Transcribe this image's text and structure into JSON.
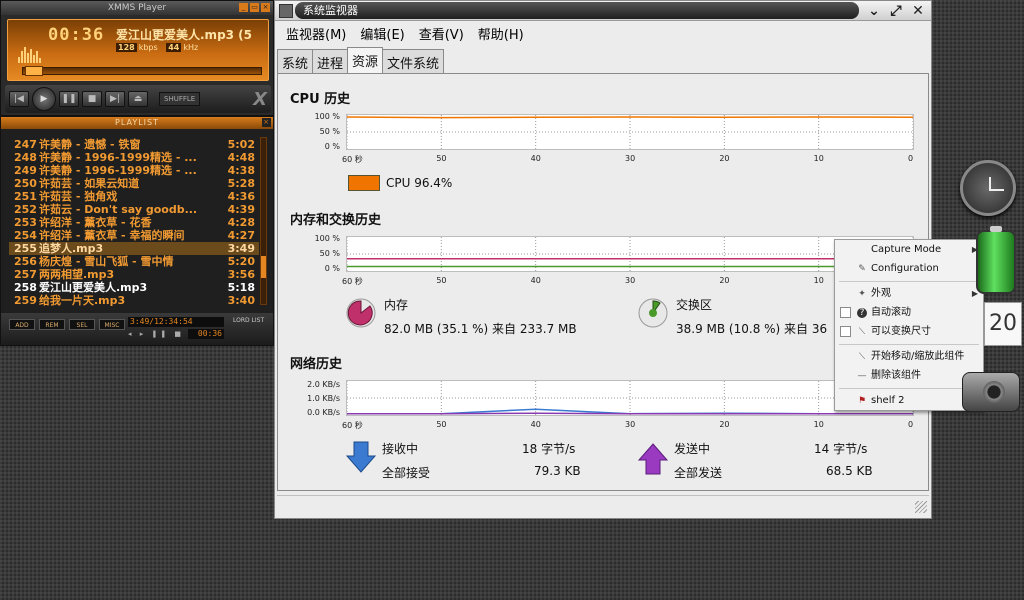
{
  "xmms": {
    "title": "XMMS Player",
    "time": "00:36",
    "song": "爱江山更爱美人.mp3 (5",
    "bitrate": "128",
    "bitrate_unit": "kbps",
    "samplerate": "44",
    "samplerate_unit": "kHz",
    "shuffle_label": "SHUFFLE",
    "logo": "X"
  },
  "playlist": {
    "title": "PLAYLIST",
    "rows": [
      {
        "num": "247",
        "title": "许美静 - 遗憾 - 铁窗",
        "dur": "5:02"
      },
      {
        "num": "248",
        "title": "许美静 - 1996-1999精选 - ...",
        "dur": "4:48"
      },
      {
        "num": "249",
        "title": "许美静 - 1996-1999精选 - ...",
        "dur": "4:38"
      },
      {
        "num": "250",
        "title": "许茹芸 - 如果云知道",
        "dur": "5:28"
      },
      {
        "num": "251",
        "title": "许茹芸 - 独角戏",
        "dur": "4:36"
      },
      {
        "num": "252",
        "title": "许茹云 - Don't say goodb...",
        "dur": "4:39"
      },
      {
        "num": "253",
        "title": "许绍洋 - 薰衣草 - 花香",
        "dur": "4:28"
      },
      {
        "num": "254",
        "title": "许绍洋 - 薰衣草 - 幸福的瞬间",
        "dur": "4:27"
      },
      {
        "num": "255",
        "title": "追梦人.mp3",
        "dur": "3:49"
      },
      {
        "num": "256",
        "title": "杨庆煌 - 雪山飞狐 - 雪中情",
        "dur": "5:20"
      },
      {
        "num": "257",
        "title": "两两相望.mp3",
        "dur": "3:56"
      },
      {
        "num": "258",
        "title": "爱江山更爱美人.mp3",
        "dur": "5:18"
      },
      {
        "num": "259",
        "title": "给我一片天.mp3",
        "dur": "3:40"
      }
    ],
    "buttons": [
      "ADD",
      "REM",
      "SEL",
      "MISC"
    ],
    "total_time": "3:49/12:34:54",
    "small_time": "00:36",
    "lord_list": "LORD LIST"
  },
  "sysmon": {
    "window_title": "系统监视器",
    "menu": [
      "监视器(M)",
      "编辑(E)",
      "查看(V)",
      "帮助(H)"
    ],
    "tabs": [
      "系统",
      "进程",
      "资源",
      "文件系统"
    ],
    "cpu": {
      "title": "CPU 历史",
      "legend": "CPU 96.4%"
    },
    "mem": {
      "title": "内存和交换历史",
      "mem_label": "内存",
      "mem_value": "82.0 MB (35.1 %) 来自 233.7 MB",
      "swap_label": "交换区",
      "swap_value": "38.9 MB (10.8 %) 来自 36"
    },
    "net": {
      "title": "网络历史",
      "recv_label": "接收中",
      "recv_rate": "18 字节/s",
      "recv_total_label": "全部接受",
      "recv_total": "79.3 KB",
      "send_label": "发送中",
      "send_rate": "14 字节/s",
      "send_total_label": "全部发送",
      "send_total": "68.5 KB"
    },
    "x_ticks": [
      "60 秒",
      "50",
      "40",
      "30",
      "20",
      "10",
      "0"
    ],
    "pct_ticks": [
      "100 %",
      "50 %",
      "0 %"
    ],
    "net_ticks": [
      "2.0 KB/s",
      "1.0 KB/s",
      "0.0 KB/s"
    ],
    "colors": {
      "cpu": "#f07500",
      "mem": "#c0306a",
      "swap": "#4a9a2a",
      "recv": "#3a7ad0",
      "send": "#8a3ab0"
    }
  },
  "chart_data": [
    {
      "type": "line",
      "title": "CPU 历史",
      "xlabel": "",
      "ylabel": "",
      "x": [
        60,
        50,
        40,
        30,
        20,
        10,
        0
      ],
      "ylim": [
        0,
        100
      ],
      "series": [
        {
          "name": "CPU",
          "values": [
            97,
            95,
            96,
            97,
            96,
            97,
            96.4
          ]
        }
      ]
    },
    {
      "type": "line",
      "title": "内存和交换历史",
      "x": [
        60,
        50,
        40,
        30,
        20,
        10,
        0
      ],
      "ylim": [
        0,
        100
      ],
      "series": [
        {
          "name": "内存",
          "values": [
            35.1,
            35.1,
            35.1,
            35.1,
            35.1,
            35.1,
            35.1
          ]
        },
        {
          "name": "交换区",
          "values": [
            10.8,
            10.8,
            10.8,
            10.8,
            10.8,
            10.8,
            10.8
          ]
        }
      ]
    },
    {
      "type": "line",
      "title": "网络历史",
      "x": [
        60,
        50,
        40,
        30,
        20,
        10,
        0
      ],
      "ylim": [
        0,
        2.0
      ],
      "series": [
        {
          "name": "接收中",
          "values": [
            0.02,
            0.02,
            0.3,
            0.02,
            0.05,
            0.02,
            0.02
          ]
        },
        {
          "name": "发送中",
          "values": [
            0.01,
            0.01,
            0.05,
            0.01,
            0.02,
            0.01,
            0.01
          ]
        }
      ]
    }
  ],
  "context_menu": {
    "items": [
      {
        "label": "Capture Mode",
        "submenu": true
      },
      {
        "label": "Configuration",
        "submenu": false
      },
      {
        "label": "外观",
        "submenu": true
      },
      {
        "label": "自动滚动",
        "submenu": false
      },
      {
        "label": "可以变换尺寸",
        "submenu": false
      },
      {
        "label": "开始移动/缩放此组件",
        "submenu": false
      },
      {
        "label": "删除该组件",
        "submenu": false
      },
      {
        "label": "shelf 2",
        "submenu": true
      }
    ]
  },
  "desktop": {
    "calendar_day": "20"
  }
}
